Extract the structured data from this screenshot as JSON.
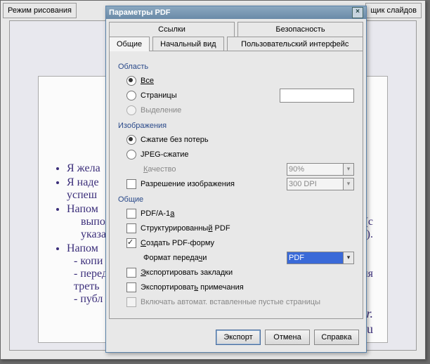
{
  "bg": {
    "tab_draw": "Режим рисования",
    "tab_sorter": "щик слайдов",
    "bullets": [
      "Я жела",
      "Я наде",
      "успеш",
      "Напом",
      "выпол",
      "указан",
      "Напом",
      "- копи",
      "- перед",
      "треть",
      "- публ"
    ],
    "frag_right": [
      "(с",
      "ster.ru).",
      "ания",
      "tter.",
      "aster.ru"
    ]
  },
  "dialog": {
    "title": "Параметры PDF",
    "top_tabs": {
      "links": "Ссылки",
      "security": "Безопасность"
    },
    "bottom_tabs": {
      "general": "Общие",
      "initial": "Начальный вид",
      "ui": "Пользовательский интерфейс"
    },
    "area": {
      "label": "Область",
      "all": "Все",
      "pages": "Страницы",
      "selection": "Выделение"
    },
    "images": {
      "label": "Изображения",
      "lossless": "Сжатие без потерь",
      "jpeg": "JPEG-сжатие",
      "quality": "Качество",
      "quality_val": "90%",
      "resolution": "Разрешение изображения",
      "resolution_val": "300 DPI"
    },
    "general": {
      "label": "Общие",
      "pdfa": "PDF/A-1a",
      "structured": "Структурированный PDF",
      "create_form": "Создать PDF-форму",
      "format": "Формат передачи",
      "format_val": "PDF",
      "bookmarks": "Экспортировать закладки",
      "notes": "Экспортировать примечания",
      "blank": "Включать автомат. вставленные пустые страницы"
    },
    "buttons": {
      "export": "Экспорт",
      "cancel": "Отмена",
      "help": "Справка"
    }
  }
}
